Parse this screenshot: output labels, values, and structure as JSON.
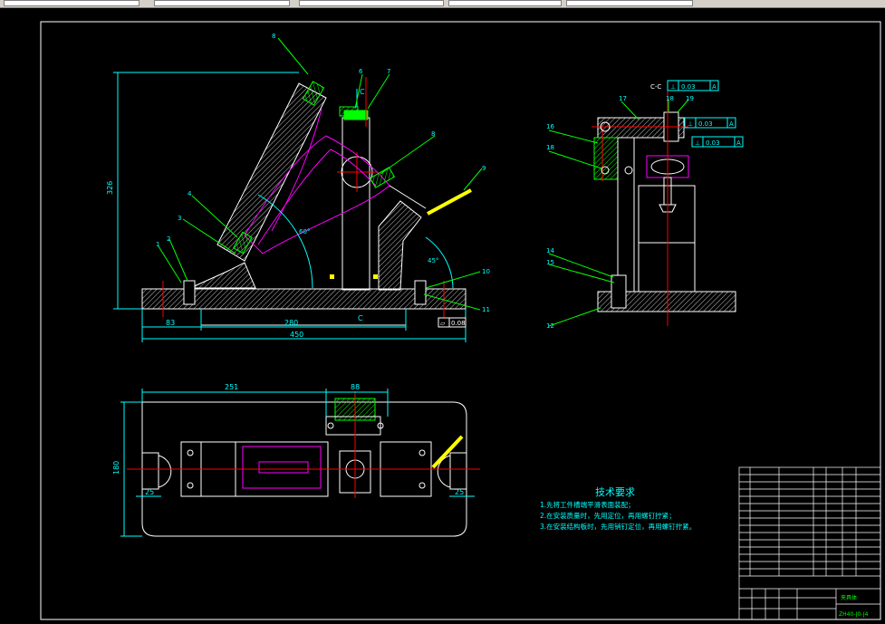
{
  "colors": {
    "background": "#000000",
    "line": "#ffffff",
    "dimension": "#00ffff",
    "leader": "#00ff00",
    "hatch": "#c0c0c0",
    "workpiece": "#ff00ff",
    "centerline": "#ff0000",
    "handle": "#ffff00"
  },
  "front_view": {
    "dim_overall_width": "450",
    "dim_left": "83",
    "dim_middle": "280",
    "dim_height": "326",
    "section_mark": "C",
    "flatness_symbol": "⏥",
    "flatness_value": "0.08",
    "angle_label_1": "60°",
    "angle_label_2": "45°",
    "parts": [
      "1",
      "2",
      "3",
      "4",
      "5",
      "6",
      "7",
      "8",
      "9",
      "10",
      "11"
    ]
  },
  "side_view": {
    "section_label": "C-C",
    "tol_1_symbol": "⊥",
    "tol_1_value": "0.03",
    "tol_1_datum": "A",
    "tol_2_symbol": "⊥",
    "tol_2_value": "0.03",
    "tol_2_datum": "A",
    "tol_3_symbol": "⊥",
    "tol_3_value": "0.03",
    "tol_3_datum": "A",
    "parts": [
      "12",
      "13",
      "14",
      "15",
      "16",
      "17",
      "18",
      "19"
    ]
  },
  "top_view": {
    "dim_left_len": "251",
    "dim_clamp": "88",
    "dim_height": "180",
    "dim_slot_left": "25",
    "dim_slot_right": "25"
  },
  "tech_requirements": {
    "title": "技术要求",
    "items": [
      "1.先将工件槽端平滑表面装配；",
      "2.在安装质量时，先用定位，再用螺钉拧紧；",
      "3.在安装结构板时，先用销钉定位，再用螺钉拧紧。"
    ]
  },
  "title_block": {
    "name": "夹具体",
    "drawing_no": "ZH40-J0-J4"
  }
}
